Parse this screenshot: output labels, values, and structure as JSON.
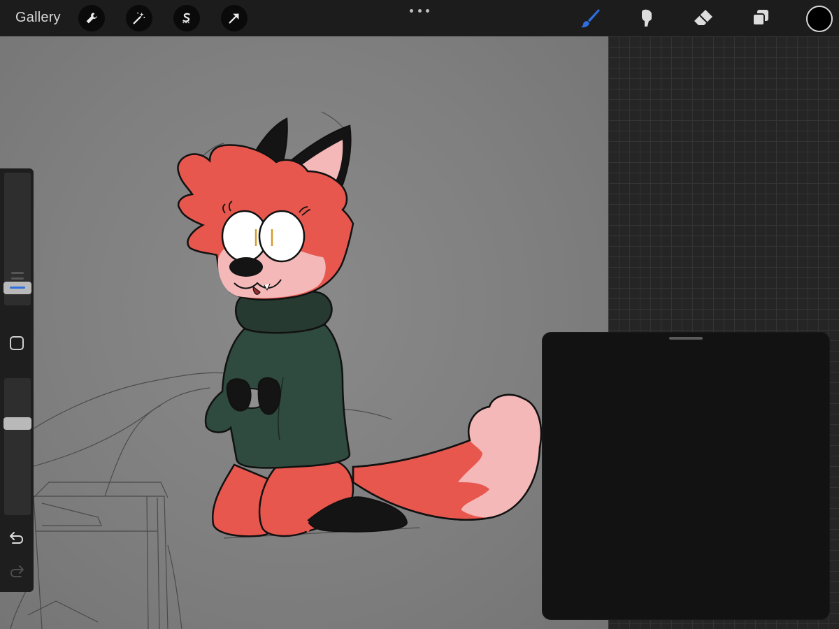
{
  "toolbar": {
    "gallery_label": "Gallery",
    "left_tools": [
      "wrench-icon",
      "magic-wand-icon",
      "selection-icon",
      "transform-arrow-icon"
    ],
    "more_menu": "more-dots-icon",
    "right_tools": [
      "brush-icon",
      "smudge-icon",
      "eraser-icon",
      "layers-icon"
    ],
    "active_tool": "brush",
    "active_tool_color": "#2f6fe0",
    "current_color": "#000000"
  },
  "sidebar": {
    "brush_size_level": 0.45,
    "opacity_level": 0.8,
    "modifier_button": "square-modifier-icon",
    "undo": "undo-icon",
    "redo": "redo-icon"
  },
  "canvas": {
    "background_color": "#808080",
    "character_colors": {
      "fur": "#e8574e",
      "light_fur": "#f4b8b8",
      "sweater": "#2f4a3e",
      "ears_paws": "#141414"
    }
  },
  "reference_panel": {
    "background": "#121212"
  }
}
